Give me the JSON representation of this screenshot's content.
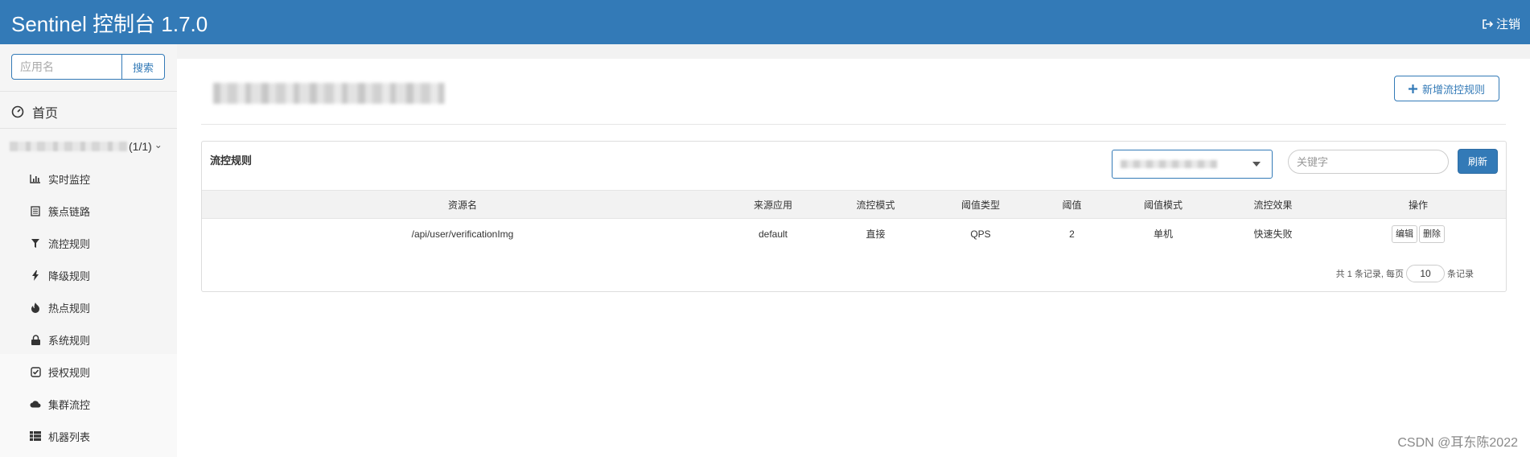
{
  "header": {
    "title": "Sentinel 控制台 1.7.0",
    "logout_label": "注销"
  },
  "sidebar": {
    "search_placeholder": "应用名",
    "search_button": "搜索",
    "home_label": "首页",
    "app_count": "(1/1)",
    "items": [
      {
        "label": "实时监控",
        "icon": "bar-chart-icon"
      },
      {
        "label": "簇点链路",
        "icon": "list-icon"
      },
      {
        "label": "流控规则",
        "icon": "filter-icon"
      },
      {
        "label": "降级规则",
        "icon": "flash-icon"
      },
      {
        "label": "热点规则",
        "icon": "fire-icon"
      },
      {
        "label": "系统规则",
        "icon": "lock-icon"
      },
      {
        "label": "授权规则",
        "icon": "check-icon"
      },
      {
        "label": "集群流控",
        "icon": "cloud-icon"
      },
      {
        "label": "机器列表",
        "icon": "th-list-icon"
      }
    ]
  },
  "main": {
    "add_button": "新增流控规则",
    "panel_title": "流控规则",
    "keyword_placeholder": "关键字",
    "refresh_button": "刷新",
    "columns": [
      "资源名",
      "来源应用",
      "流控模式",
      "阈值类型",
      "阈值",
      "阈值模式",
      "流控效果",
      "操作"
    ],
    "rows": [
      {
        "resource": "/api/user/verificationImg",
        "limit_app": "default",
        "strategy": "直接",
        "grade": "QPS",
        "count": "2",
        "cluster_mode": "单机",
        "effect": "快速失败",
        "edit": "编辑",
        "delete": "删除"
      }
    ],
    "pagination": {
      "prefix": "共 1 条记录, 每页",
      "page_size": "10",
      "suffix": "条记录"
    }
  },
  "watermark": "CSDN @耳东陈2022",
  "colors": {
    "primary": "#337ab7",
    "sidebar_bg": "#f5f5f5"
  }
}
